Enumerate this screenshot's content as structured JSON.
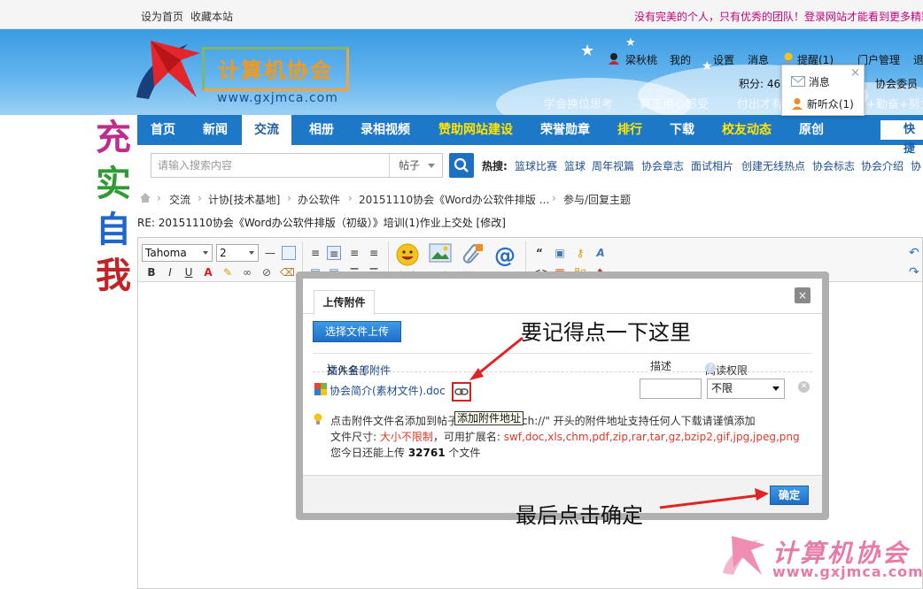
{
  "topbar": {
    "home_label": "设为首页",
    "fav_label": "收藏本站",
    "marquee": "没有完美的个人，只有优秀的团队！登录网站才能看到更多精彩"
  },
  "header": {
    "logo_name": "计算机协会",
    "logo_url": "www.gxjmca.com",
    "user": {
      "username": "梁秋桃",
      "my": "我的",
      "settings": "设置",
      "messages": "消息",
      "reminders": "提醒(1)",
      "portal_admin": "门户管理",
      "logout": "退"
    },
    "score": "积分: 46",
    "member": "协会委员",
    "slogans": [
      "学会换位思考",
      "真正用心感受",
      "付出才有",
      "+勤奋+努力"
    ]
  },
  "notify_popup": {
    "messages": "消息",
    "new_follower": "新听众(1)"
  },
  "side_art": [
    "充",
    "实",
    "自",
    "我"
  ],
  "nav": {
    "items": [
      {
        "label": "首页",
        "highlight": false,
        "active": false
      },
      {
        "label": "新闻",
        "highlight": false,
        "active": false
      },
      {
        "label": "交流",
        "highlight": false,
        "active": true
      },
      {
        "label": "相册",
        "highlight": false,
        "active": false
      },
      {
        "label": "录相视频",
        "highlight": false,
        "active": false
      },
      {
        "label": "赞助网站建设",
        "highlight": true,
        "active": false
      },
      {
        "label": "荣誉勋章",
        "highlight": false,
        "active": false
      },
      {
        "label": "排行",
        "highlight": true,
        "active": false
      },
      {
        "label": "下载",
        "highlight": false,
        "active": false
      },
      {
        "label": "校友动态",
        "highlight": true,
        "active": false
      },
      {
        "label": "原创",
        "highlight": false,
        "active": false
      }
    ],
    "quick": "快捷"
  },
  "search": {
    "placeholder": "请输入搜索内容",
    "type": "帖子",
    "hot_label": "热搜:",
    "hot_items": [
      "篮球比赛",
      "篮球",
      "周年视篇",
      "协会章志",
      "面试相片",
      "创建无线热点",
      "协会标志",
      "协会介绍",
      "协"
    ]
  },
  "breadcrumb": [
    "交流",
    "计协[技术基地]",
    "办公软件",
    "20151110协会《Word办公软件排版 ...",
    "参与/回复主题"
  ],
  "page_title": "RE: 20151110协会《Word办公软件排版（初级）》培训(1)作业上交处 [修改]",
  "editor_toolbar": {
    "font": "Tahoma",
    "size": "2",
    "big_buttons": [
      "表情",
      "图片",
      "附件",
      "@朋"
    ]
  },
  "dialog": {
    "tab": "上传附件",
    "close": "×",
    "upload_button": "选择文件上传",
    "col_filename": "文件名 (",
    "col_insert_all": "插入全部附件",
    "col_close_paren": ")",
    "col_desc": "描述",
    "col_perm": "阅读权限",
    "file_name": "协会简介(素材文件).doc",
    "perm_value": "不限",
    "tooltip": "添加附件地址",
    "tip_line1_a": "点击附件文件名添加到帖子",
    "tip_line1_b": "ch://\" 开头的附件地址支持任何人下载请谨慎添加",
    "tip_line2_prefix": "文件尺寸: ",
    "tip_line2_size": "大小不限制",
    "tip_line2_mid": "，可用扩展名: ",
    "tip_line2_exts": "swf,doc,xls,chm,pdf,zip,rar,tar,gz,bzip2,gif,jpg,jpeg,png",
    "tip_line3_prefix": "您今日还能上传 ",
    "tip_line3_count": "32761",
    "tip_line3_suffix": " 个文件",
    "ok_button": "确定"
  },
  "annotations": {
    "note1": "要记得点一下这里",
    "note2": "最后点击确定"
  },
  "watermark": {
    "name": "计算机协会",
    "url": "www.gxjmca.com"
  },
  "colors": {
    "nav_blue": "#1d78c8",
    "nav_highlight": "#ffe600",
    "button_blue": "#1f6fc7",
    "annotation_red": "#e02424",
    "watermark_pink": "#e77ba8"
  }
}
